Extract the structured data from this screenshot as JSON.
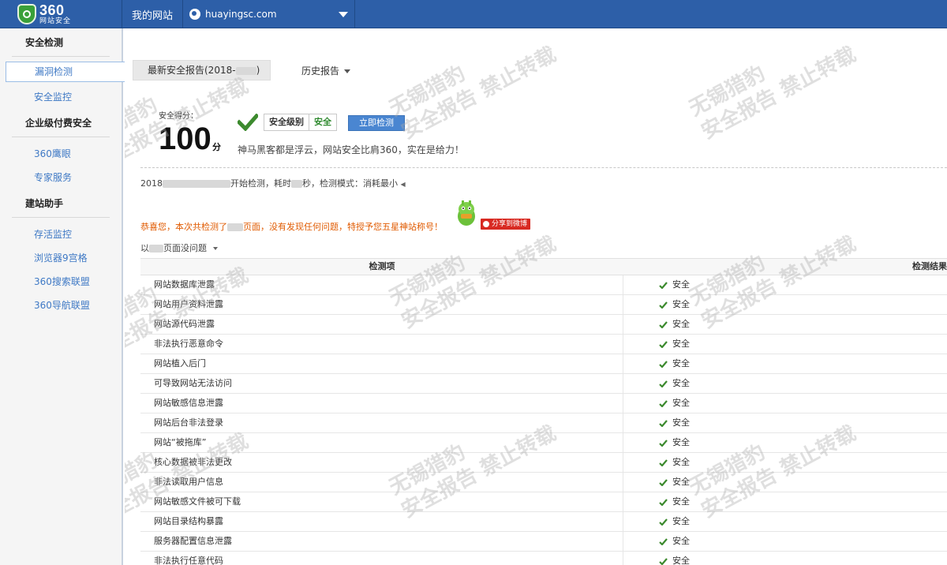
{
  "header": {
    "logo": {
      "number": "360",
      "subtitle": "网站安全"
    },
    "my_site": "我的网站",
    "site_domain": "huayingsc.com"
  },
  "sidebar": {
    "groups": [
      {
        "title": "安全检测",
        "items": [
          {
            "label": "漏洞检测",
            "active": true
          },
          {
            "label": "安全监控"
          }
        ]
      },
      {
        "title": "企业级付费安全",
        "items": [
          {
            "label": "360鹰眼"
          },
          {
            "label": "专家服务"
          }
        ]
      },
      {
        "title": "建站助手",
        "items": [
          {
            "label": "存活监控"
          },
          {
            "label": "浏览器9宫格"
          },
          {
            "label": "360搜索联盟"
          },
          {
            "label": "360导航联盟"
          }
        ]
      }
    ]
  },
  "report": {
    "latest_tab": "最新安全报告(2018-",
    "latest_tab_end": ")",
    "history_tab": "历史报告",
    "score_label": "安全得分：",
    "score": "100",
    "score_unit": "分",
    "level_key": "安全级别",
    "level_value": "安全",
    "scan_button": "立即检测",
    "praise": "神马黑客都是浮云，网站安全比肩360，实在是给力！",
    "scan_info_prefix": "2018",
    "scan_info_mid": "开始检测，耗时",
    "scan_info_suffix": "秒，检测模式：消耗最小",
    "congrats_prefix": "恭喜您，本次共检测了",
    "congrats_suffix": "页面，没有发现任何问题，特授予您五星神站称号！",
    "weibo_share": "分享到微博",
    "no_issue_prefix": "以",
    "no_issue_suffix": "页面没问题"
  },
  "table": {
    "col_item": "检测项",
    "col_result": "检测结果",
    "rows": [
      {
        "item": "网站数据库泄露",
        "result": "安全"
      },
      {
        "item": "网站用户资料泄露",
        "result": "安全"
      },
      {
        "item": "网站源代码泄露",
        "result": "安全"
      },
      {
        "item": "非法执行恶意命令",
        "result": "安全"
      },
      {
        "item": "网站植入后门",
        "result": "安全"
      },
      {
        "item": "可导致网站无法访问",
        "result": "安全"
      },
      {
        "item": "网站敏感信息泄露",
        "result": "安全"
      },
      {
        "item": "网站后台非法登录",
        "result": "安全"
      },
      {
        "item": "网站“被拖库”",
        "result": "安全"
      },
      {
        "item": "核心数据被非法更改",
        "result": "安全"
      },
      {
        "item": "非法读取用户信息",
        "result": "安全"
      },
      {
        "item": "网站敏感文件被可下载",
        "result": "安全"
      },
      {
        "item": "网站目录结构暴露",
        "result": "安全"
      },
      {
        "item": "服务器配置信息泄露",
        "result": "安全"
      },
      {
        "item": "非法执行任意代码",
        "result": "安全"
      }
    ]
  },
  "watermark": {
    "line1": "无锡猎豹",
    "line2": "安全报告 禁止转载"
  },
  "colors": {
    "topbar": "#2d5fa8",
    "link": "#3f79c5",
    "safe_green": "#2f8a2f",
    "congrats_orange": "#e05a00",
    "weibo_red": "#d82a22"
  }
}
